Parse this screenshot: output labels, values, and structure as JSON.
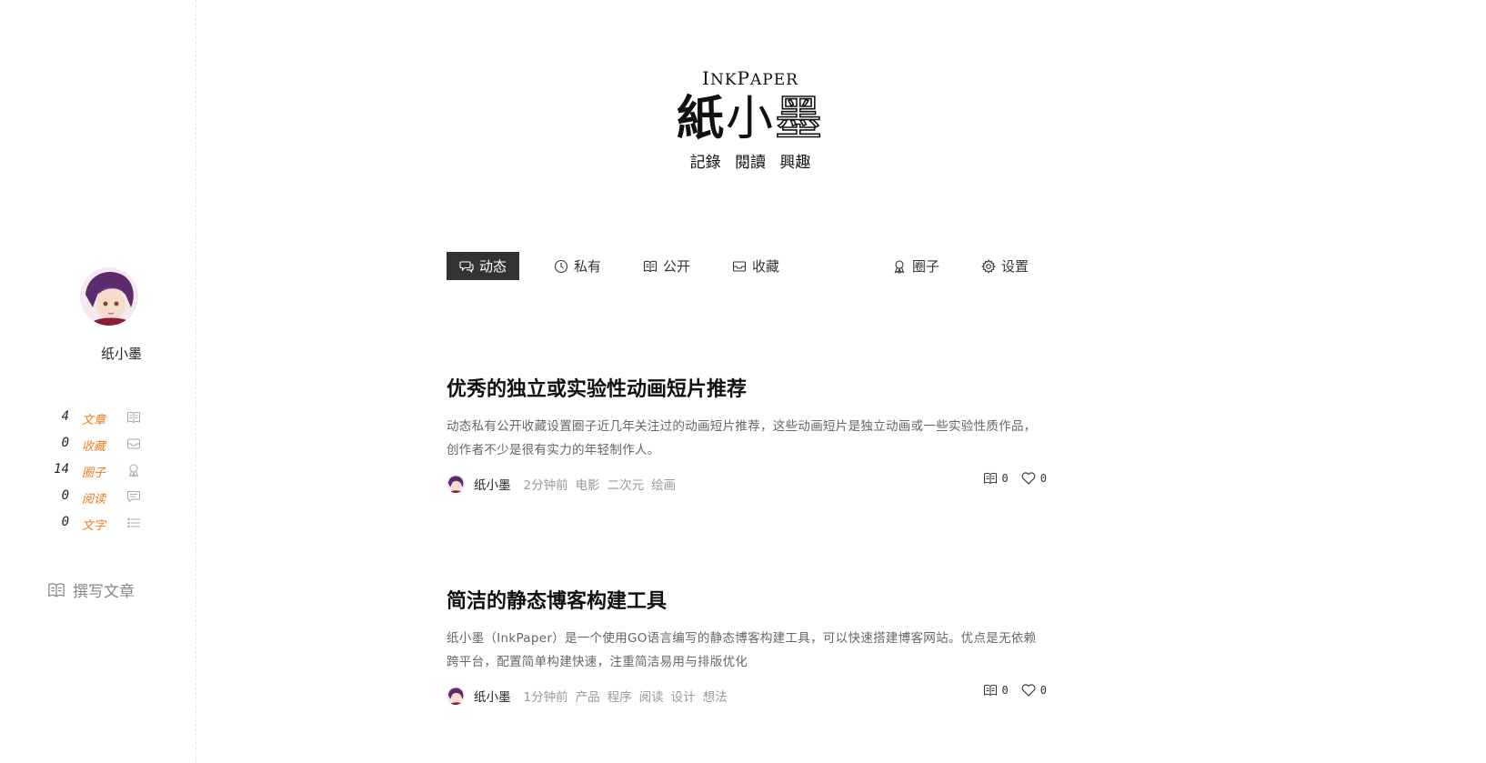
{
  "logo": {
    "en_cap1": "I",
    "en_rest1": "NK",
    "en_cap2": "P",
    "en_rest2": "APER",
    "cn_char1": "紙",
    "cn_char2": "小",
    "cn_char3": "墨",
    "subtitle": "記錄 閱讀 興趣"
  },
  "sidebar": {
    "user_name": "纸小墨",
    "stats": [
      {
        "count": "4",
        "label": "文章",
        "icon": "book-icon"
      },
      {
        "count": "0",
        "label": "收藏",
        "icon": "inbox-icon"
      },
      {
        "count": "14",
        "label": "圈子",
        "icon": "award-icon"
      },
      {
        "count": "0",
        "label": "阅读",
        "icon": "comment-icon"
      },
      {
        "count": "0",
        "label": "文字",
        "icon": "list-icon"
      }
    ],
    "write_label": "撰写文章"
  },
  "nav": {
    "items": [
      {
        "label": "动态",
        "icon": "chat-icon",
        "active": true
      },
      {
        "label": "私有",
        "icon": "clock-icon"
      },
      {
        "label": "公开",
        "icon": "book-icon"
      },
      {
        "label": "收藏",
        "icon": "inbox-icon"
      },
      {
        "label": "圈子",
        "icon": "award-icon"
      },
      {
        "label": "设置",
        "icon": "gear-icon"
      }
    ]
  },
  "posts": [
    {
      "title": "优秀的独立或实验性动画短片推荐",
      "excerpt": "动态私有公开收藏设置圈子近几年关注过的动画短片推荐，这些动画短片是独立动画或一些实验性质作品，创作者不少是很有实力的年轻制作人。",
      "author": "纸小墨",
      "time": "2分钟前",
      "tags": [
        "电影",
        "二次元",
        "绘画"
      ],
      "read_count": "0",
      "like_count": "0"
    },
    {
      "title": "简洁的静态博客构建工具",
      "excerpt": "纸小墨（InkPaper）是一个使用GO语言编写的静态博客构建工具，可以快速搭建博客网站。优点是无依赖跨平台，配置简单构建快速，注重简洁易用与排版优化",
      "author": "纸小墨",
      "time": "1分钟前",
      "tags": [
        "产品",
        "程序",
        "阅读",
        "设计",
        "想法"
      ],
      "read_count": "0",
      "like_count": "0"
    }
  ],
  "colors": {
    "accent": "#f07c1e",
    "nav_active_bg": "#333333",
    "muted": "#999999"
  }
}
